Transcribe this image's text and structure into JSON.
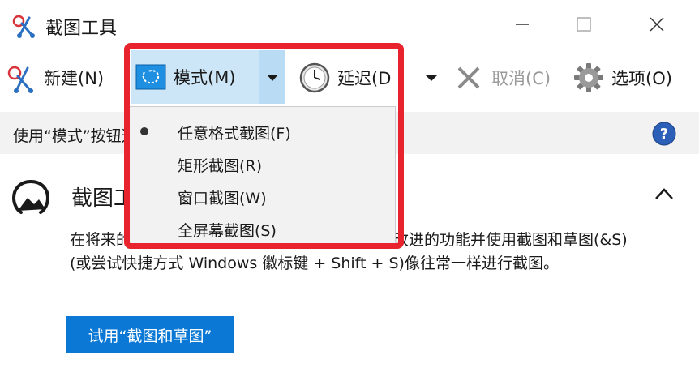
{
  "window": {
    "title": "截图工具"
  },
  "toolbar": {
    "new_label": "新建(N)",
    "mode_label": "模式(M)",
    "delay_label": "延迟(D",
    "cancel_label": "取消(C)",
    "options_label": "选项(O)"
  },
  "infobar": {
    "text": "使用“模式”按钮选择截图类型，或单击“新建”按钮。"
  },
  "mode_menu": {
    "items": [
      {
        "label": "任意格式截图(F)"
      },
      {
        "label": "矩形截图(R)"
      },
      {
        "label": "窗口截图(W)"
      },
      {
        "label": "全屏幕截图(S)"
      }
    ]
  },
  "card": {
    "title": "截图工具正在移动",
    "body": "在将来的更新中，截图工具将移到新的家。尝试改进的功能并使用截图和草图(&S)(或尝试快捷方式 Windows 徽标键 + Shift + S)像往常一样进行截图。",
    "button_label": "试用“截图和草图”"
  },
  "colors": {
    "accent": "#0a78d4",
    "highlight_border": "#e8232e",
    "mode_selected": "#cde6f7",
    "infobar_bg": "#f2f2f2"
  },
  "icons": {
    "app": "scissors-icon",
    "mode": "freeform-snip-icon",
    "delay": "clock-icon",
    "cancel": "x-icon",
    "options": "gear-icon",
    "help": "help-icon",
    "card": "snip-sketch-icon"
  }
}
